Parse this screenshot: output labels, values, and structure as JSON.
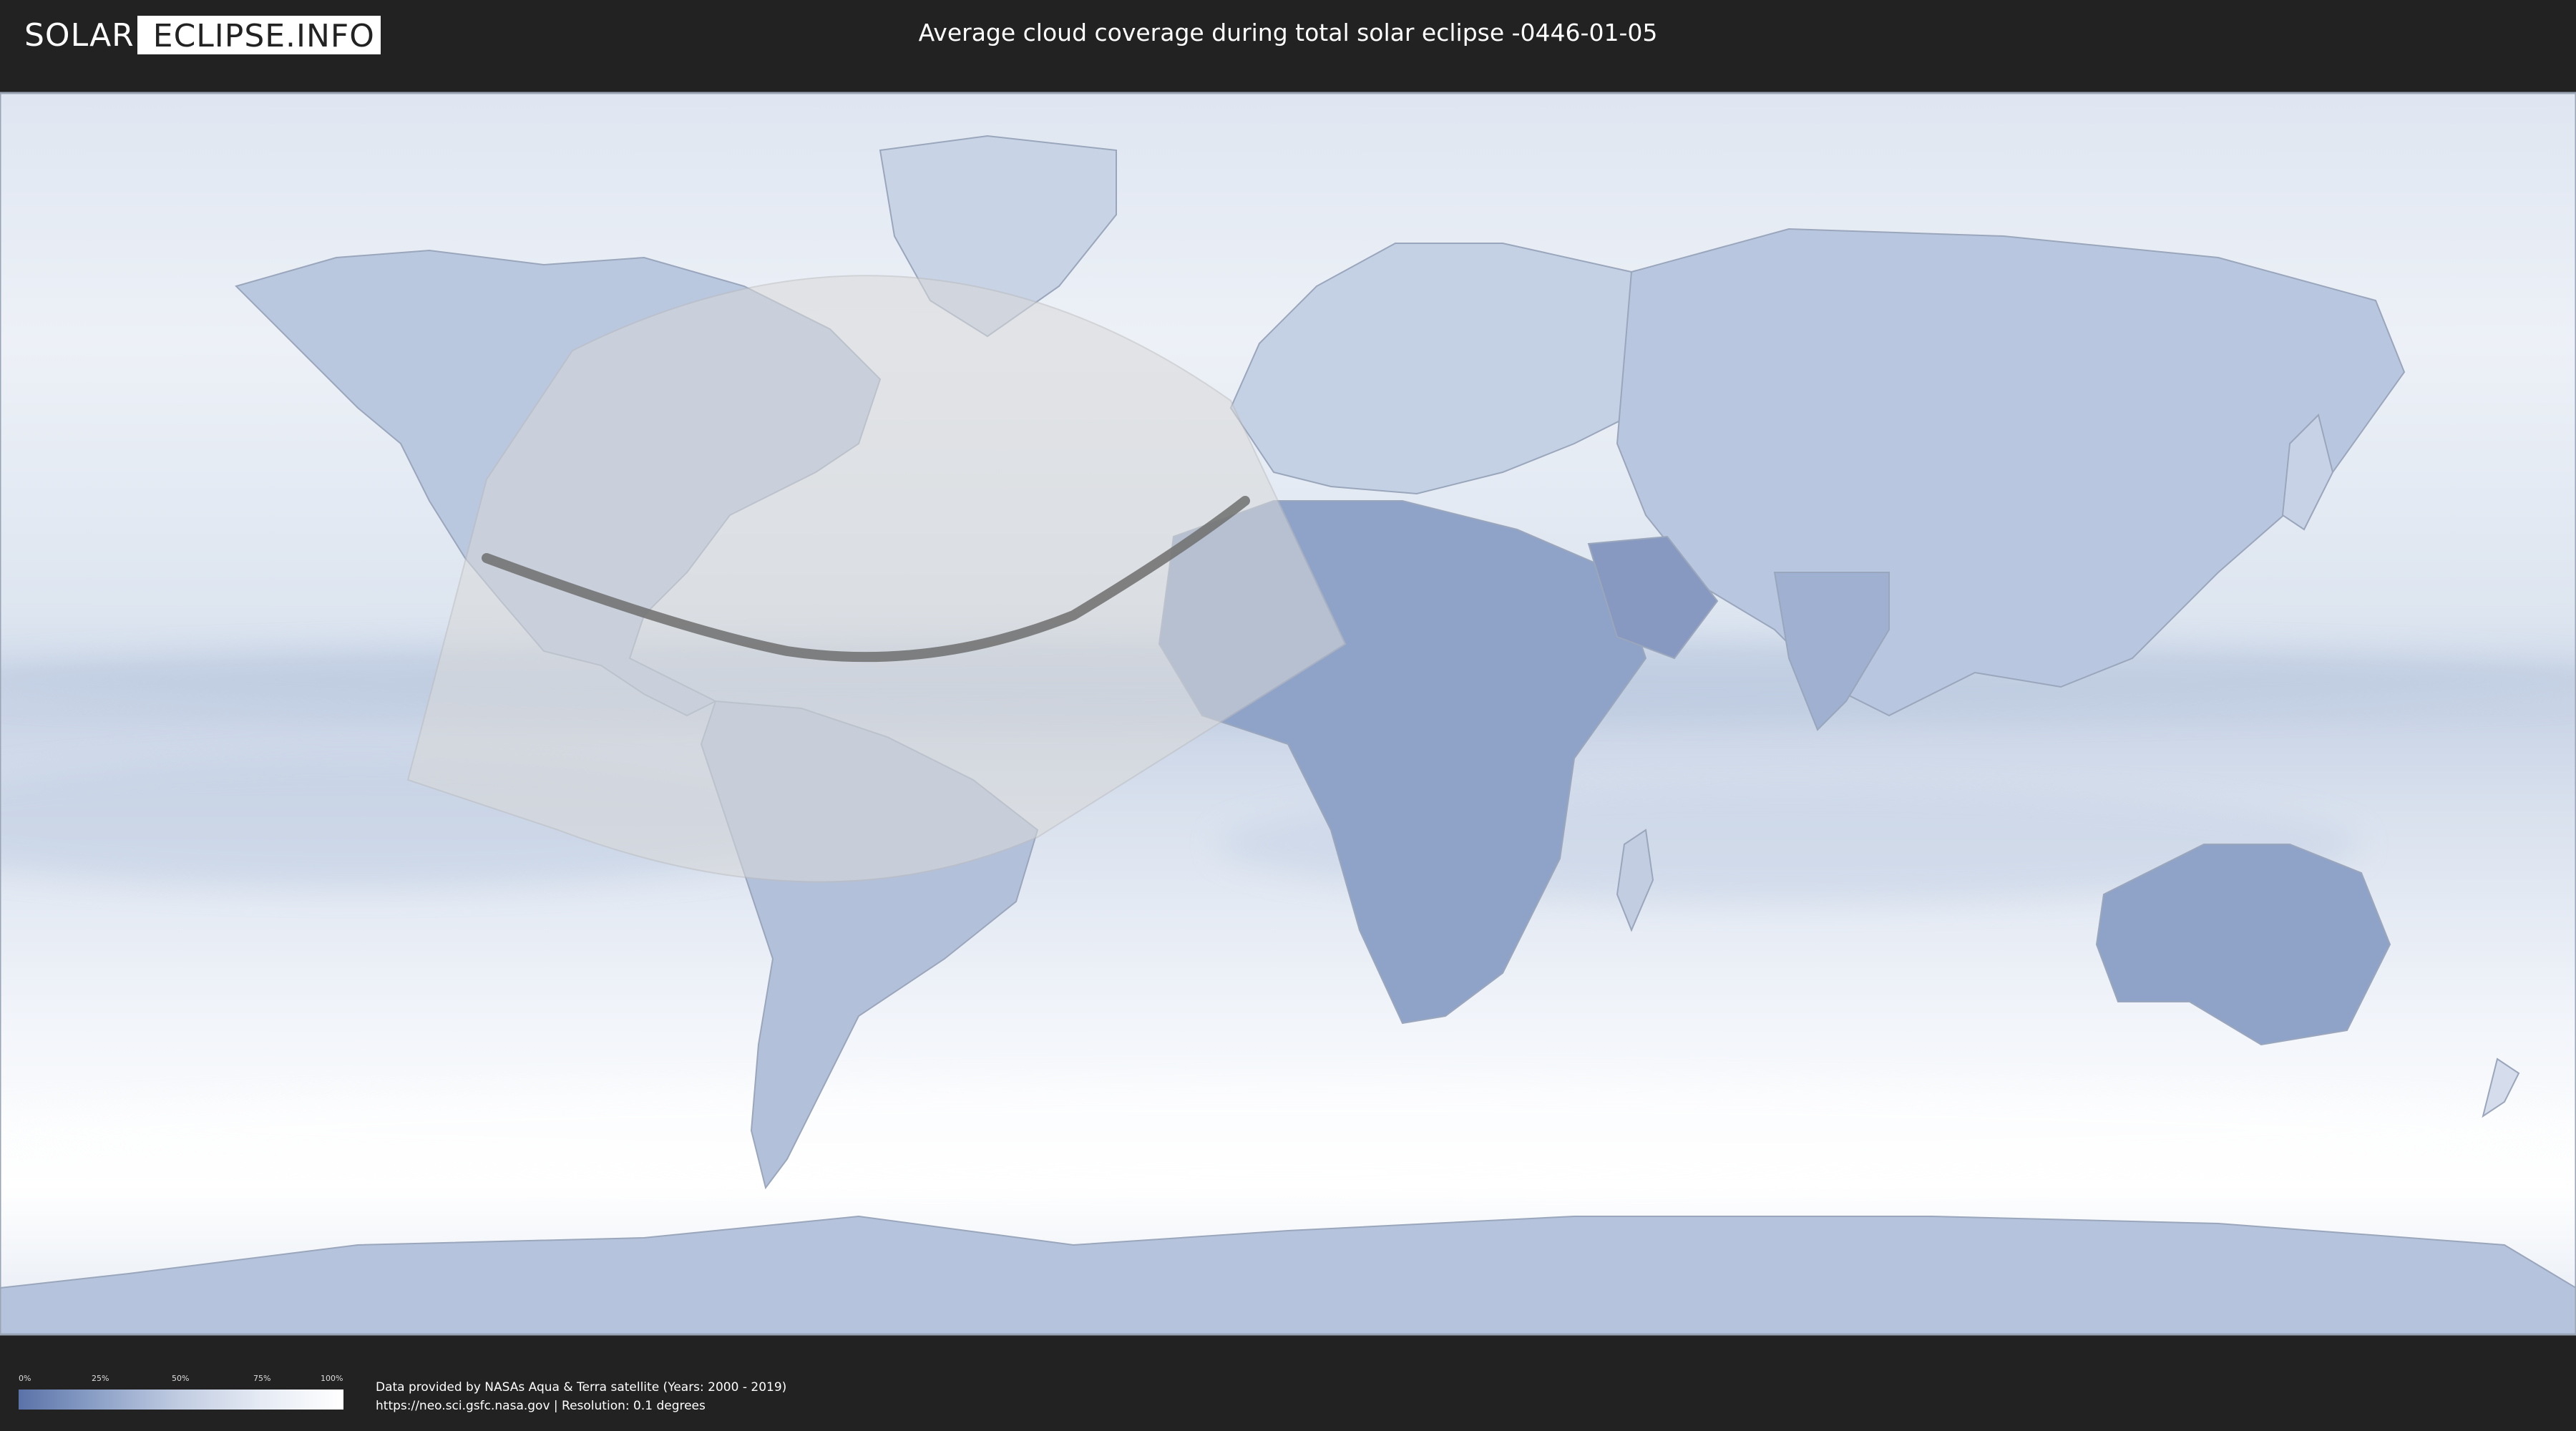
{
  "header": {
    "logo_left": "SOLAR",
    "logo_right": "ECLIPSE.INFO",
    "title": "Average cloud coverage during total solar eclipse -0446-01-05"
  },
  "legend": {
    "ticks": [
      "0%",
      "25%",
      "50%",
      "75%",
      "100%"
    ],
    "gradient_colors": [
      "#5a72a8",
      "#8ea2c8",
      "#c2cde2",
      "#e6ebf4",
      "#ffffff"
    ]
  },
  "credits": {
    "line1": "Data provided by NASAs Aqua & Terra satellite (Years: 2000 - 2019)",
    "line2": "https://neo.sci.gsfc.nasa.gov | Resolution: 0.1 degrees"
  },
  "colors": {
    "background": "#222222",
    "cloud_low": "#5a72a8",
    "cloud_high": "#ffffff",
    "eclipse_path": "#6e6e6e",
    "visibility_zone": "#d9d9d9"
  }
}
